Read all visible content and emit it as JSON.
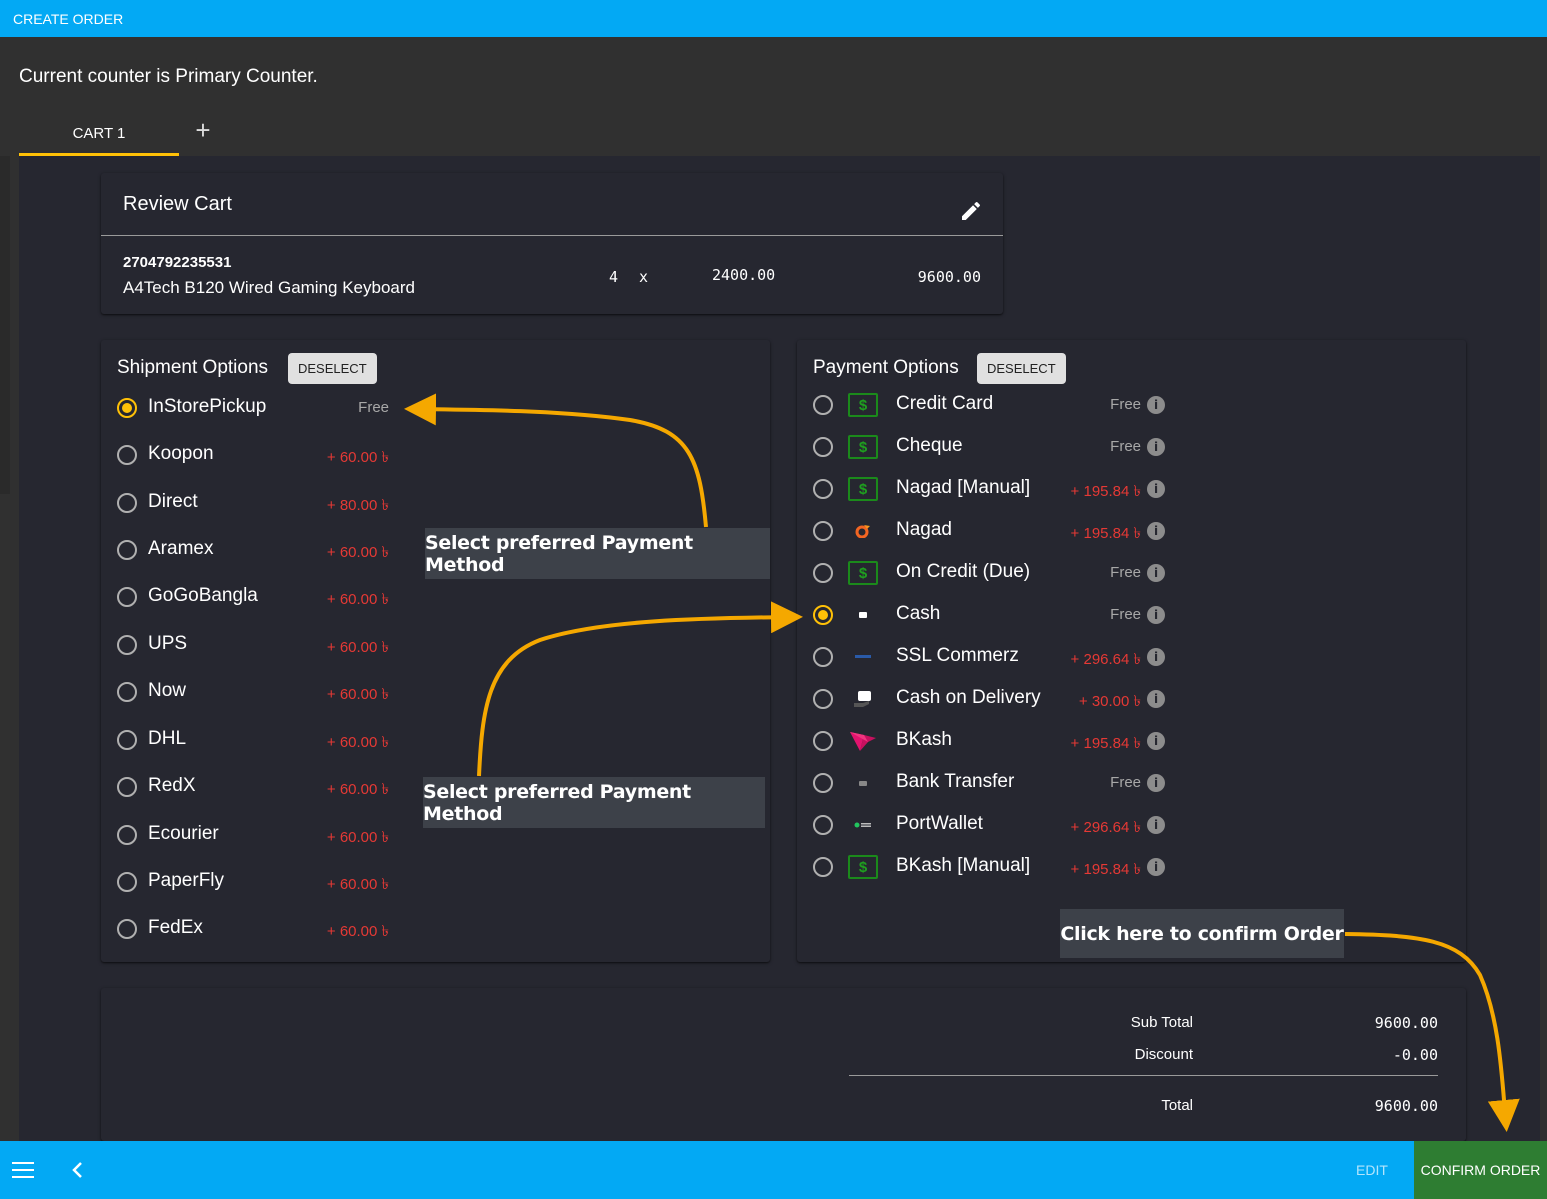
{
  "header": {
    "title": "CREATE ORDER"
  },
  "counter_message": "Current counter is Primary Counter.",
  "tabs": [
    {
      "label": "CART 1",
      "active": true
    }
  ],
  "add_tab_label": "+",
  "review_cart": {
    "title": "Review Cart",
    "items": [
      {
        "sku": "2704792235531",
        "name": "A4Tech B120 Wired Gaming Keyboard",
        "qty": "4",
        "times": "x",
        "unit_price": "2400.00",
        "line_total": "9600.00"
      }
    ]
  },
  "shipment": {
    "title": "Shipment Options",
    "deselect_label": "DESELECT",
    "options": [
      {
        "label": "InStorePickup",
        "fee": "Free",
        "selected": true
      },
      {
        "label": "Koopon",
        "fee": "+ 60.00 ৳",
        "selected": false
      },
      {
        "label": "Direct",
        "fee": "+ 80.00 ৳",
        "selected": false
      },
      {
        "label": "Aramex",
        "fee": "+ 60.00 ৳",
        "selected": false
      },
      {
        "label": "GoGoBangla",
        "fee": "+ 60.00 ৳",
        "selected": false
      },
      {
        "label": "UPS",
        "fee": "+ 60.00 ৳",
        "selected": false
      },
      {
        "label": "Now",
        "fee": "+ 60.00 ৳",
        "selected": false
      },
      {
        "label": "DHL",
        "fee": "+ 60.00 ৳",
        "selected": false
      },
      {
        "label": "RedX",
        "fee": "+ 60.00 ৳",
        "selected": false
      },
      {
        "label": "Ecourier",
        "fee": "+ 60.00 ৳",
        "selected": false
      },
      {
        "label": "PaperFly",
        "fee": "+ 60.00 ৳",
        "selected": false
      },
      {
        "label": "FedEx",
        "fee": "+ 60.00 ৳",
        "selected": false
      }
    ]
  },
  "payment": {
    "title": "Payment Options",
    "deselect_label": "DESELECT",
    "options": [
      {
        "label": "Credit Card",
        "fee": "Free",
        "icon": "dollar-icon",
        "selected": false
      },
      {
        "label": "Cheque",
        "fee": "Free",
        "icon": "dollar-icon",
        "selected": false
      },
      {
        "label": "Nagad [Manual]",
        "fee": "+ 195.84 ৳",
        "icon": "dollar-icon",
        "selected": false
      },
      {
        "label": "Nagad",
        "fee": "+ 195.84 ৳",
        "icon": "nagad-logo-icon",
        "selected": false
      },
      {
        "label": "On Credit (Due)",
        "fee": "Free",
        "icon": "dollar-icon",
        "selected": false
      },
      {
        "label": "Cash",
        "fee": "Free",
        "icon": "cash-icon",
        "selected": true
      },
      {
        "label": "SSL Commerz",
        "fee": "+ 296.64 ৳",
        "icon": "sslcommerz-logo-icon",
        "selected": false
      },
      {
        "label": "Cash on Delivery",
        "fee": "+ 30.00 ৳",
        "icon": "cash-on-delivery-icon",
        "selected": false
      },
      {
        "label": "BKash",
        "fee": "+ 195.84 ৳",
        "icon": "bkash-logo-icon",
        "selected": false
      },
      {
        "label": "Bank Transfer",
        "fee": "Free",
        "icon": "bank-card-icon",
        "selected": false
      },
      {
        "label": "PortWallet",
        "fee": "+ 296.64 ৳",
        "icon": "portwallet-logo-icon",
        "selected": false
      },
      {
        "label": "BKash [Manual]",
        "fee": "+ 195.84 ৳",
        "icon": "dollar-icon",
        "selected": false
      }
    ]
  },
  "summary": {
    "rows": [
      {
        "label": "Sub Total",
        "value": "9600.00"
      },
      {
        "label": "Discount",
        "value": "-0.00"
      },
      {
        "label": "Total",
        "value": "9600.00"
      }
    ]
  },
  "callouts": {
    "shipment_hint": "Select preferred Payment Method",
    "payment_hint": "Select preferred Payment Method",
    "confirm_hint": "Click here to confirm Order"
  },
  "footer": {
    "edit_label": "EDIT",
    "confirm_label": "CONFIRM ORDER"
  },
  "colors": {
    "primary": "#03a9f4",
    "accent": "#ffc107",
    "confirm": "#2e7d32",
    "fee_red": "#e53935",
    "annotation_arrow": "#f5a800"
  }
}
